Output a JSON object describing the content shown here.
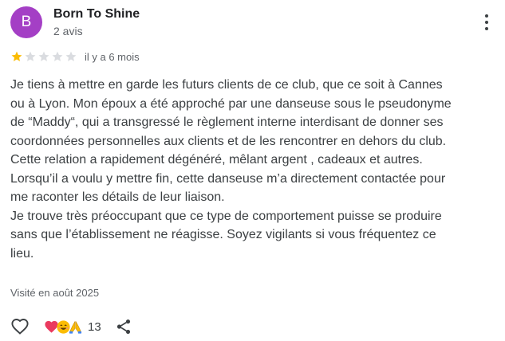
{
  "author": {
    "avatar_letter": "B",
    "avatar_color": "#a43fc5",
    "name": "Born To Shine",
    "reviews": "2 avis"
  },
  "menu_icon": "more-vert-icon",
  "rating": {
    "stars": 1,
    "max": 5,
    "filled_color": "#fbbc04",
    "empty_color": "#dadce0",
    "time": "il y a 6 mois"
  },
  "review_lines": [
    "Je tiens à mettre en garde les futurs clients de ce club, que ce soit à Cannes",
    "ou à Lyon. Mon époux a été approché par une danseuse sous le pseudonyme",
    "de “Maddy“, qui a transgressé le règlement interne interdisant de donner ses",
    "coordonnées personnelles aux clients et de les rencontrer en dehors du club.",
    "Cette relation a rapidement dégénéré, mêlant argent , cadeaux et autres.",
    "Lorsqu’il a voulu y mettre fin, cette danseuse m’a directement contactée pour",
    "me raconter les détails de leur liaison.",
    "Je trouve très préoccupant que ce type de comportement puisse se produire",
    "sans que l’établissement ne réagisse. Soyez vigilants si vous fréquentez ce",
    "lieu."
  ],
  "visit": "Visité en août 2025",
  "actions": {
    "like_icon": "heart-outline-icon",
    "reaction_icons": [
      "heart-emoji-icon",
      "smile-emoji-icon",
      "pray-emoji-icon"
    ],
    "reaction_count": "13",
    "share_icon": "share-icon"
  }
}
